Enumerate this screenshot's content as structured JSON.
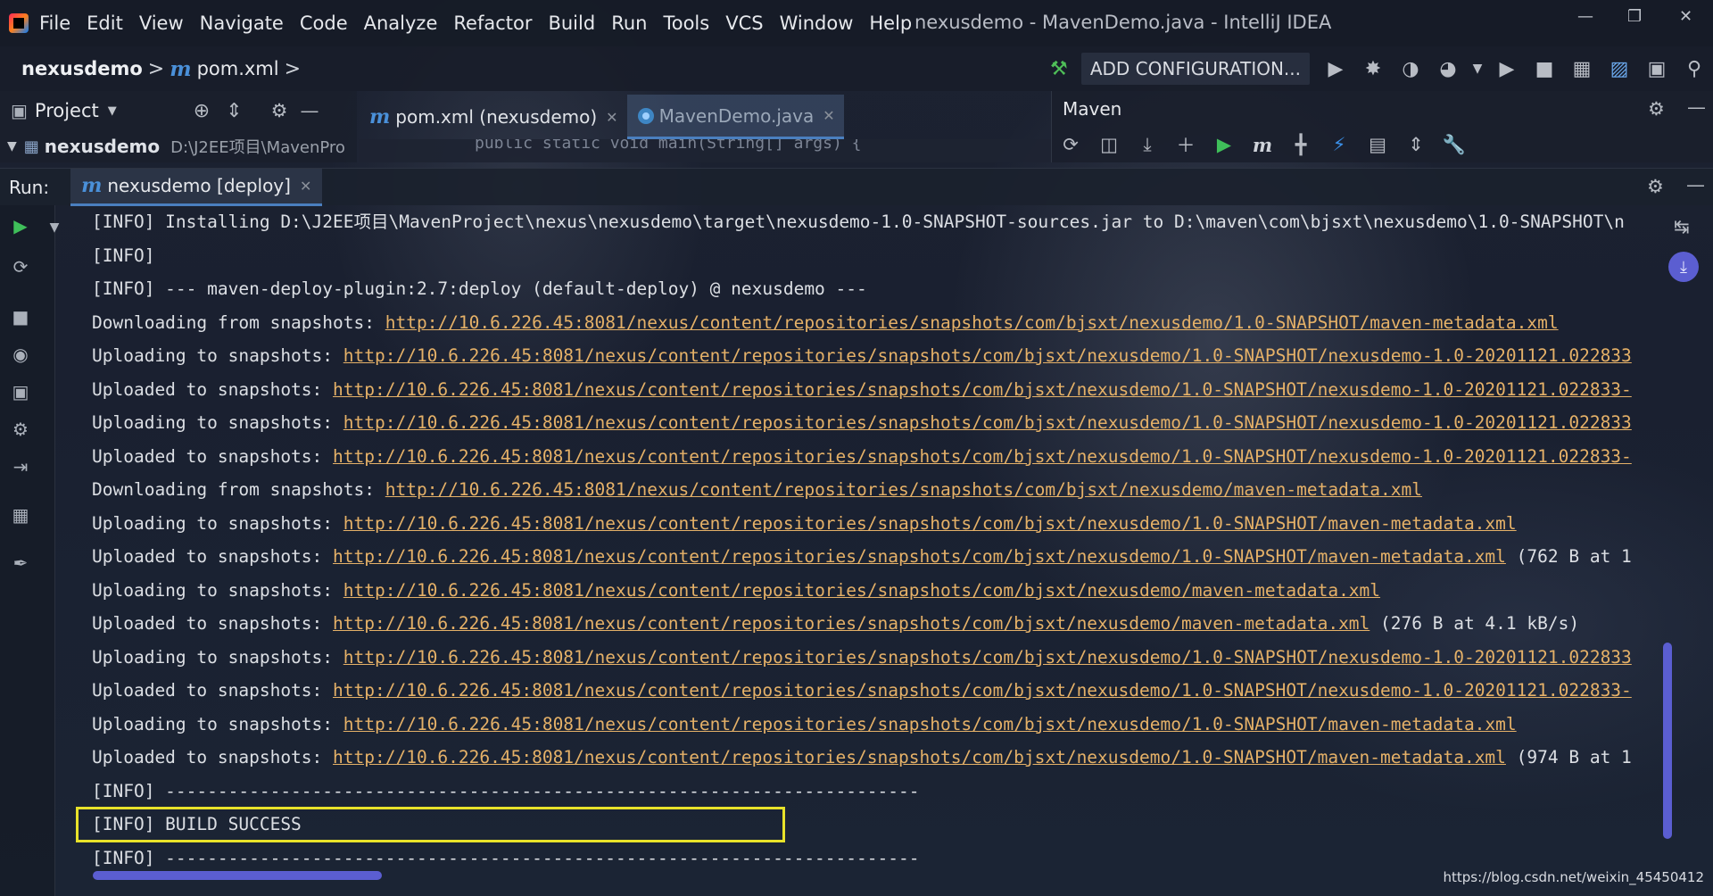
{
  "menubar": {
    "items": [
      "File",
      "Edit",
      "View",
      "Navigate",
      "Code",
      "Analyze",
      "Refactor",
      "Build",
      "Run",
      "Tools",
      "VCS",
      "Window",
      "Help"
    ],
    "window_title": "nexusdemo - MavenDemo.java - IntelliJ IDEA"
  },
  "navbar": {
    "project": "nexusdemo",
    "sep": ">",
    "file_prefix": "m",
    "file": "pom.xml",
    "sep2": ">",
    "add_config": "ADD CONFIGURATION..."
  },
  "project_panel": {
    "label": "Project",
    "tree_project": "nexusdemo",
    "tree_path": "D:\\J2EE项目\\MavenPro"
  },
  "editor": {
    "tabs": [
      {
        "prefix": "m",
        "label": "pom.xml (nexusdemo)"
      },
      {
        "label": "MavenDemo.java"
      }
    ],
    "peek_code": "public static void main(String[] args) {"
  },
  "maven_panel": {
    "title": "Maven"
  },
  "run_panel": {
    "label": "Run:",
    "tab_prefix": "m",
    "tab_label": "nexusdemo [deploy]"
  },
  "console": {
    "lines": [
      {
        "text": "[INFO] Installing D:\\J2EE项目\\MavenProject\\nexus\\nexusdemo\\target\\nexusdemo-1.0-SNAPSHOT-sources.jar to D:\\maven\\com\\bjsxt\\nexusdemo\\1.0-SNAPSHOT\\n",
        "url": "",
        "suffix": ""
      },
      {
        "text": "[INFO]",
        "url": "",
        "suffix": ""
      },
      {
        "text": "[INFO] --- maven-deploy-plugin:2.7:deploy (default-deploy) @ nexusdemo ---",
        "url": "",
        "suffix": ""
      },
      {
        "text": "Downloading from snapshots: ",
        "url": "http://10.6.226.45:8081/nexus/content/repositories/snapshots/com/bjsxt/nexusdemo/1.0-SNAPSHOT/maven-metadata.xml",
        "suffix": ""
      },
      {
        "text": "Uploading to snapshots: ",
        "url": "http://10.6.226.45:8081/nexus/content/repositories/snapshots/com/bjsxt/nexusdemo/1.0-SNAPSHOT/nexusdemo-1.0-20201121.022833",
        "suffix": ""
      },
      {
        "text": "Uploaded to snapshots: ",
        "url": "http://10.6.226.45:8081/nexus/content/repositories/snapshots/com/bjsxt/nexusdemo/1.0-SNAPSHOT/nexusdemo-1.0-20201121.022833-",
        "suffix": ""
      },
      {
        "text": "Uploading to snapshots: ",
        "url": "http://10.6.226.45:8081/nexus/content/repositories/snapshots/com/bjsxt/nexusdemo/1.0-SNAPSHOT/nexusdemo-1.0-20201121.022833",
        "suffix": ""
      },
      {
        "text": "Uploaded to snapshots: ",
        "url": "http://10.6.226.45:8081/nexus/content/repositories/snapshots/com/bjsxt/nexusdemo/1.0-SNAPSHOT/nexusdemo-1.0-20201121.022833-",
        "suffix": ""
      },
      {
        "text": "Downloading from snapshots: ",
        "url": "http://10.6.226.45:8081/nexus/content/repositories/snapshots/com/bjsxt/nexusdemo/maven-metadata.xml",
        "suffix": ""
      },
      {
        "text": "Uploading to snapshots: ",
        "url": "http://10.6.226.45:8081/nexus/content/repositories/snapshots/com/bjsxt/nexusdemo/1.0-SNAPSHOT/maven-metadata.xml",
        "suffix": ""
      },
      {
        "text": "Uploaded to snapshots: ",
        "url": "http://10.6.226.45:8081/nexus/content/repositories/snapshots/com/bjsxt/nexusdemo/1.0-SNAPSHOT/maven-metadata.xml",
        "suffix": " (762 B at 1"
      },
      {
        "text": "Uploading to snapshots: ",
        "url": "http://10.6.226.45:8081/nexus/content/repositories/snapshots/com/bjsxt/nexusdemo/maven-metadata.xml",
        "suffix": ""
      },
      {
        "text": "Uploaded to snapshots: ",
        "url": "http://10.6.226.45:8081/nexus/content/repositories/snapshots/com/bjsxt/nexusdemo/maven-metadata.xml",
        "suffix": " (276 B at 4.1 kB/s)"
      },
      {
        "text": "Uploading to snapshots: ",
        "url": "http://10.6.226.45:8081/nexus/content/repositories/snapshots/com/bjsxt/nexusdemo/1.0-SNAPSHOT/nexusdemo-1.0-20201121.022833",
        "suffix": ""
      },
      {
        "text": "Uploaded to snapshots: ",
        "url": "http://10.6.226.45:8081/nexus/content/repositories/snapshots/com/bjsxt/nexusdemo/1.0-SNAPSHOT/nexusdemo-1.0-20201121.022833-",
        "suffix": ""
      },
      {
        "text": "Uploading to snapshots: ",
        "url": "http://10.6.226.45:8081/nexus/content/repositories/snapshots/com/bjsxt/nexusdemo/1.0-SNAPSHOT/maven-metadata.xml",
        "suffix": ""
      },
      {
        "text": "Uploaded to snapshots: ",
        "url": "http://10.6.226.45:8081/nexus/content/repositories/snapshots/com/bjsxt/nexusdemo/1.0-SNAPSHOT/maven-metadata.xml",
        "suffix": " (974 B at 1"
      },
      {
        "text": "[INFO] ------------------------------------------------------------------------",
        "url": "",
        "suffix": ""
      },
      {
        "text": "[INFO] BUILD SUCCESS",
        "url": "",
        "suffix": ""
      },
      {
        "text": "[INFO] ------------------------------------------------------------------------",
        "url": "",
        "suffix": ""
      }
    ]
  },
  "watermark": "https://blog.csdn.net/weixin_45450412",
  "icons": {
    "run": "run-icon",
    "debug": "debug-icon",
    "coverage": "coverage-icon",
    "profile": "profile-icon",
    "stop": "stop-icon",
    "build": "hammer-icon",
    "search": "search-icon",
    "settings": "gear-icon"
  },
  "colors": {
    "url": "#e5b168",
    "highlight": "#e8e22a",
    "scrollbar": "#5b5ed1",
    "accent": "#4a7fbf",
    "run_green": "#3fbf5a"
  }
}
